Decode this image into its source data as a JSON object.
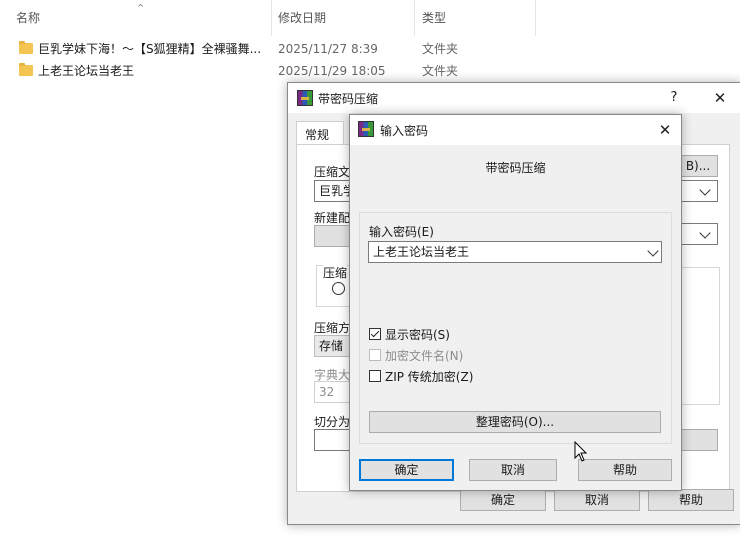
{
  "explorer": {
    "columns": {
      "name": "名称",
      "date": "修改日期",
      "type": "类型"
    },
    "files": [
      {
        "name": "巨乳学妹下海！～【S狐狸精】全裸骚舞...",
        "date": "2025/11/27 8:39",
        "type": "文件夹"
      },
      {
        "name": "上老王论坛当老王",
        "date": "2025/11/29 18:05",
        "type": "文件夹"
      }
    ]
  },
  "archive_dialog": {
    "title": "带密码压缩",
    "help_glyph": "?",
    "close_glyph": "✕",
    "tab_general": "常规",
    "archive_name_label": "压缩文",
    "archive_name_value": "巨乳学",
    "browse_button": "B)...",
    "new_profile_label": "新建配",
    "compress_label": "压缩",
    "compress_method_label": "压缩方",
    "compress_method_value": "存储",
    "dict_size_label": "字典大",
    "dict_size_value": "32",
    "split_label": "切分为",
    "ok": "确定",
    "cancel": "取消",
    "help": "帮助"
  },
  "password_dialog": {
    "title": "输入密码",
    "close_glyph": "✕",
    "header": "带密码压缩",
    "password_label": "输入密码(E)",
    "password_value": "上老王论坛当老王",
    "show_password": {
      "label": "显示密码(S)",
      "checked": true
    },
    "encrypt_names": {
      "label": "加密文件名(N)",
      "checked": false,
      "disabled": true
    },
    "zip_legacy": {
      "label": "ZIP 传统加密(Z)",
      "checked": false
    },
    "organize_button": "整理密码(O)...",
    "ok": "确定",
    "cancel": "取消",
    "help": "帮助"
  }
}
